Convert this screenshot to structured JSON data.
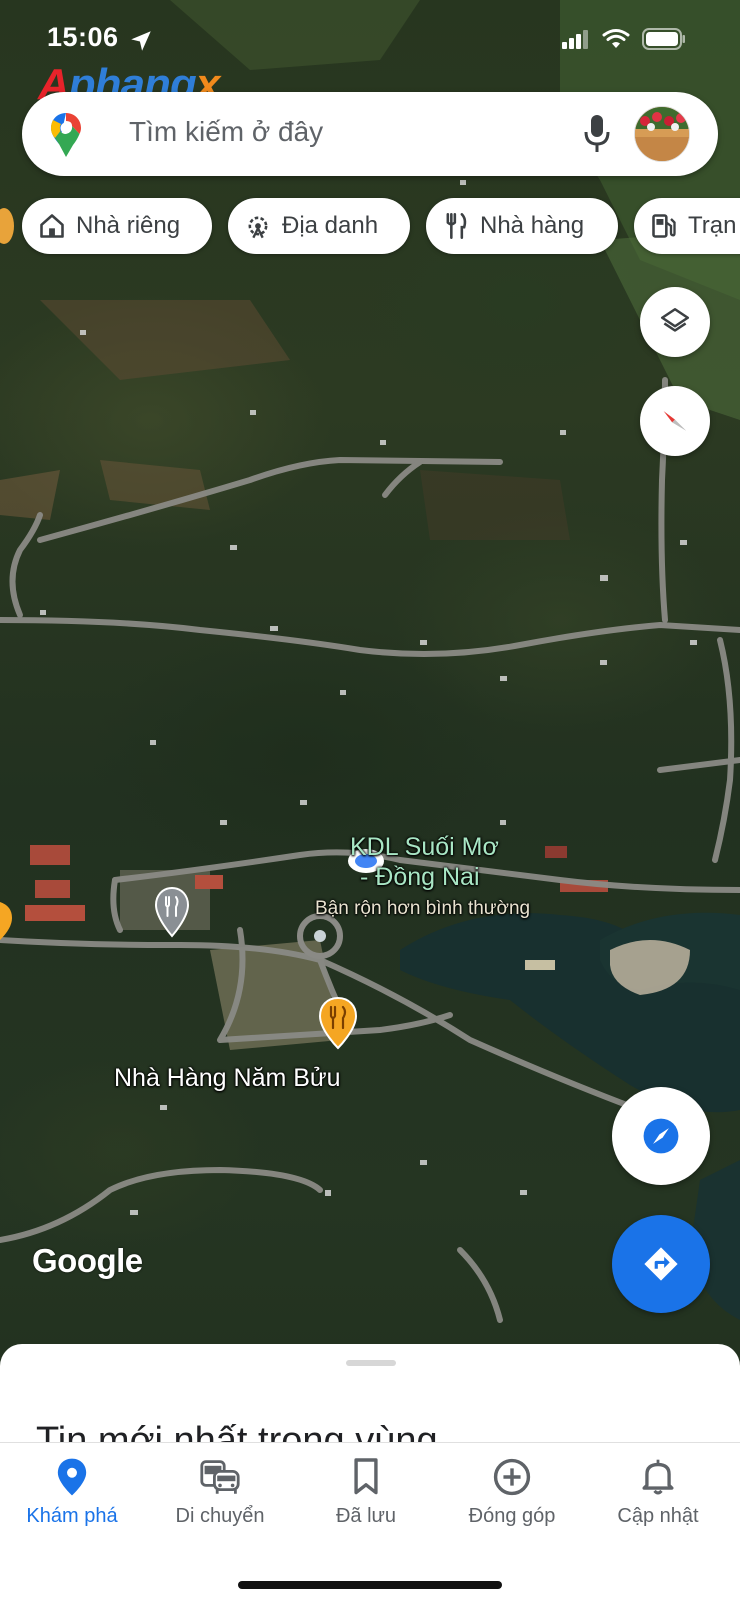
{
  "status_bar": {
    "time": "15:06",
    "icons": [
      "location-arrow-icon",
      "signal-icon",
      "wifi-icon",
      "battery-icon"
    ]
  },
  "watermark": {
    "part1": "A",
    "part2": "phang",
    "part3": "x"
  },
  "search": {
    "placeholder": "Tìm kiếm ở đây",
    "icons": [
      "google-maps-pin-icon",
      "microphone-icon"
    ]
  },
  "chips": [
    {
      "label": "Nhà riêng",
      "icon": "home-icon"
    },
    {
      "label": "Địa danh",
      "icon": "landmark-icon"
    },
    {
      "label": "Nhà hàng",
      "icon": "fork-knife-icon"
    },
    {
      "label": "Trạm xăng",
      "visible_label": "Trạn",
      "icon": "gas-station-icon"
    }
  ],
  "map": {
    "place_name_line1": "KDL Suối Mơ",
    "place_name_line2": "- Đồng Nai",
    "place_status": "Bận rộn hơn bình thường",
    "restaurant_label": "Nhà Hàng Năm Bửu",
    "attribution": "Google",
    "colors": {
      "place_label": "#a8e6c4",
      "restaurant_pin": "#f5a623",
      "generic_pin": "#8a8f94",
      "user_dot": "#4285f4"
    }
  },
  "bottom_sheet": {
    "title": "Tin mới nhất trong vùng"
  },
  "bottom_nav": {
    "items": [
      {
        "label": "Khám phá",
        "icon": "explore-pin-icon",
        "active": true
      },
      {
        "label": "Di chuyển",
        "icon": "commute-icon",
        "active": false
      },
      {
        "label": "Đã lưu",
        "icon": "bookmark-icon",
        "active": false
      },
      {
        "label": "Đóng góp",
        "icon": "add-circle-icon",
        "active": false
      },
      {
        "label": "Cập nhật",
        "icon": "bell-icon",
        "active": false
      }
    ]
  },
  "accent_color": "#1a73e8"
}
